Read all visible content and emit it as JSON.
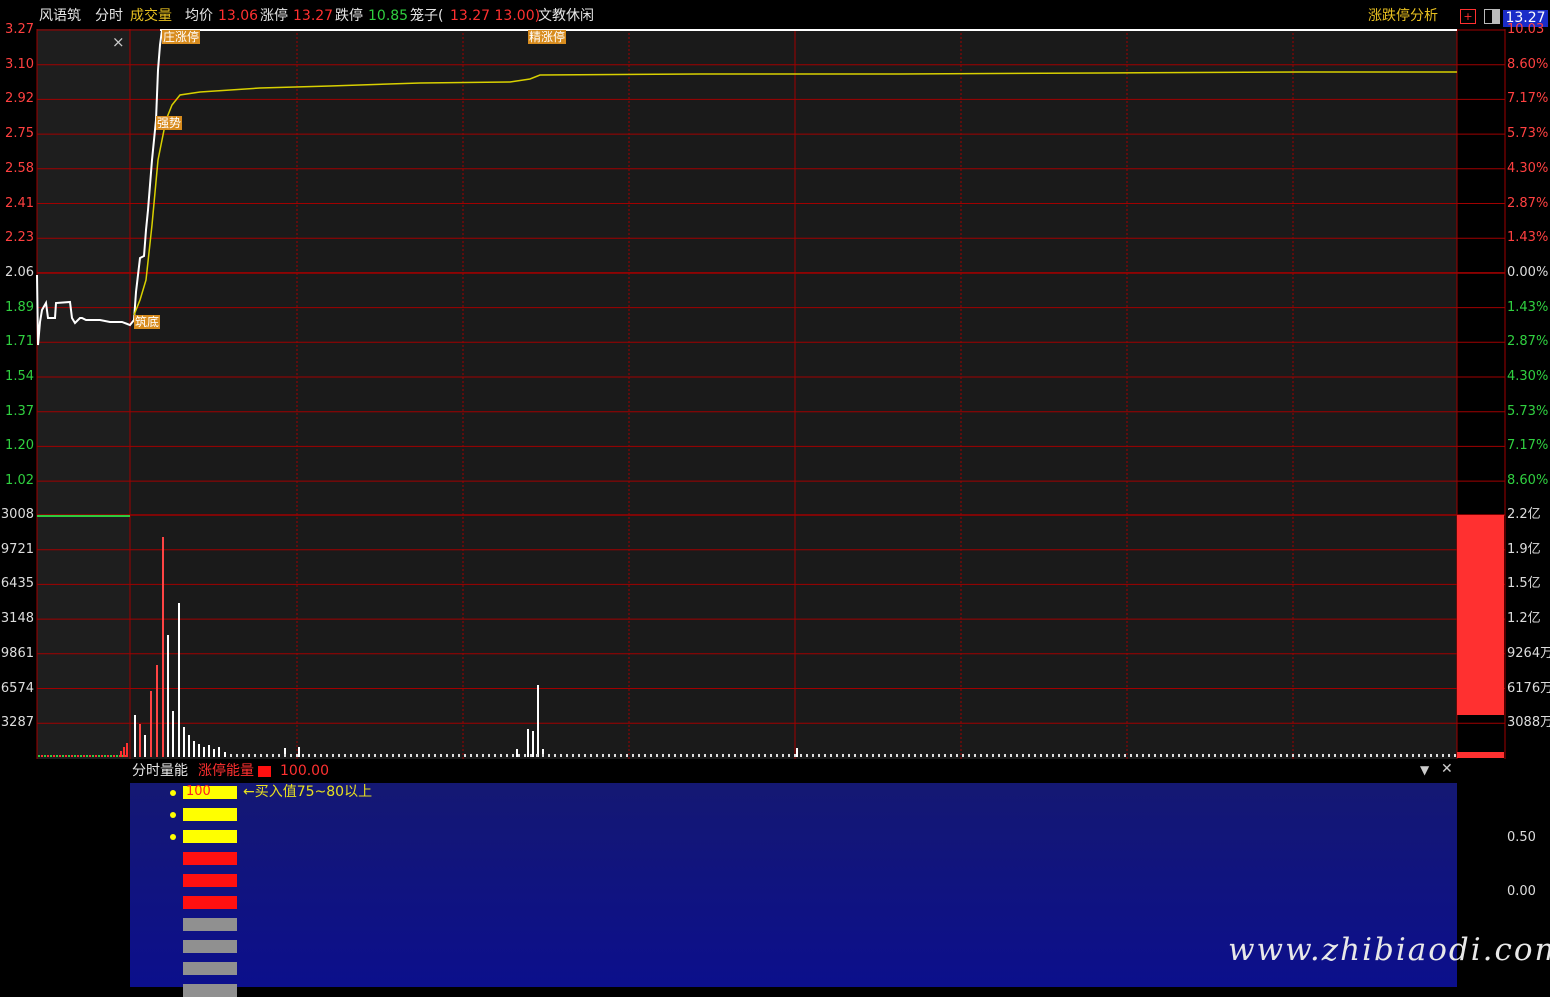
{
  "topbar": {
    "app_name": "风语筑",
    "tab_intraday": "分时",
    "tab_volume": "成交量",
    "avg_label": "均价",
    "avg_value": "13.06",
    "limit_up_label": "涨停",
    "limit_up_value": "13.27",
    "limit_down_label": "跌停",
    "limit_down_value": "10.85",
    "cage_label": "笼子(",
    "cage_value": "13.27 13.00)",
    "sector": "文教休闲",
    "analysis_button": "涨跌停分析",
    "price_box": "13.27"
  },
  "price_axis_left": [
    "3.27",
    "3.10",
    "2.92",
    "2.75",
    "2.58",
    "2.41",
    "2.23",
    "2.06",
    "1.89",
    "1.71",
    "1.54",
    "1.37",
    "1.20",
    "1.02"
  ],
  "price_axis_right": [
    "10.03",
    "8.60%",
    "7.17%",
    "5.73%",
    "4.30%",
    "2.87%",
    "1.43%",
    "0.00%",
    "1.43%",
    "2.87%",
    "4.30%",
    "5.73%",
    "7.17%",
    "8.60%"
  ],
  "volume_axis_left": [
    "3008",
    "9721",
    "6435",
    "3148",
    "9861",
    "6574",
    "3287"
  ],
  "volume_axis_right": [
    "2.2亿",
    "1.9亿",
    "1.5亿",
    "1.2亿",
    "9264万",
    "6176万",
    "3088万"
  ],
  "annotations": {
    "limit_up_a": "庄涨停",
    "limit_up_b": "精涨停",
    "strong": "强势",
    "bottom": "筑底",
    "close_x": "×"
  },
  "indicator": {
    "title": "分时量能",
    "param_label": "涨停能量",
    "param_value": "100.00",
    "bar_value": "100",
    "hint": "←买入值75~80以上",
    "axis_right": [
      "0.50",
      "0.00"
    ],
    "colors": {
      "yellow": "#ffff00",
      "red": "#ff1010",
      "gray": "#909090"
    },
    "bars": [
      "yellow",
      "yellow",
      "yellow",
      "red",
      "red",
      "red",
      "gray",
      "gray",
      "gray",
      "gray"
    ]
  },
  "watermark": "www.zhibiaodi.com",
  "colors": {
    "grid": "#a00000",
    "price_line": "#ffffff",
    "avg_line": "#d8d000",
    "up": "#ff3030",
    "down": "#2ecc40",
    "axis_text_up": "#ff4040",
    "axis_text_down": "#30d040"
  }
}
